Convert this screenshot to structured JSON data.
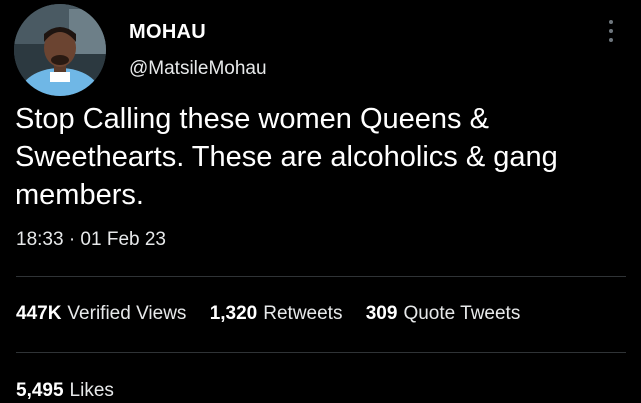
{
  "author": {
    "display_name": "MOHAU",
    "handle": "@MatsileMohau",
    "avatar_icon": "profile-photo"
  },
  "tweet": {
    "text": "Stop Calling these women Queens &\nSweethearts. These are alcoholics & gang\nmembers.",
    "timestamp": "18:33 · 01 Feb 23"
  },
  "stats": {
    "views_count": "447K",
    "views_label": "Verified Views",
    "retweets_count": "1,320",
    "retweets_label": "Retweets",
    "quotes_count": "309",
    "quotes_label": "Quote Tweets",
    "likes_count": "5,495",
    "likes_label": "Likes"
  },
  "colors": {
    "background": "#000000",
    "text": "#e7e9ea",
    "divider": "#2f3336",
    "muted": "#6e767d"
  }
}
